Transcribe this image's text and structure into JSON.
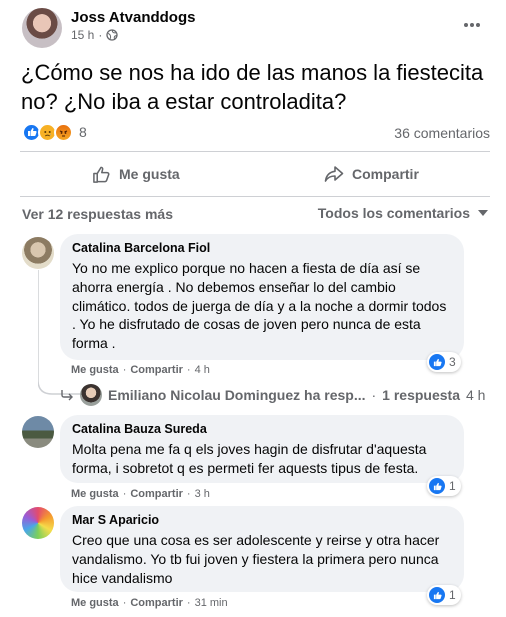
{
  "post": {
    "author": "Joss Atvanddogs",
    "time": "15 h",
    "privacy_icon": "globe-icon",
    "text": "¿Cómo se nos ha ido de las manos la fiestecita no? ¿No iba a estar controladita?",
    "reaction_count": "8",
    "comment_count": "36 comentarios"
  },
  "actions": {
    "like": "Me gusta",
    "share": "Compartir"
  },
  "comments_header": {
    "view_more": "Ver 12 respuestas más",
    "sort": "Todos los comentarios"
  },
  "comments": [
    {
      "name": "Catalina Barcelona Fiol",
      "text": "Yo no me explico porque no hacen a fiesta de día así se ahorra energía . No debemos enseñar lo del cambio climático. todos de juerga de día y a la noche a dormir todos . Yo he disfrutado de cosas de joven pero nunca de esta forma .",
      "like": "Me gusta",
      "reply": "Compartir",
      "time": "4 h",
      "reactions": "3",
      "reply_preview": {
        "text": "Emiliano Nicolau Dominguez ha resp...",
        "count": "1 respuesta",
        "time": "4 h"
      }
    },
    {
      "name": "Catalina Bauza Sureda",
      "text": "Molta pena me fa q els joves hagin de disfrutar d'aquesta forma, i sobretot q es permeti fer aquests tipus de festa.",
      "like": "Me gusta",
      "reply": "Compartir",
      "time": "3 h",
      "reactions": "1"
    },
    {
      "name": "Mar S Aparicio",
      "text": "Creo que una cosa es ser adolescente y reirse y otra hacer vandalismo. Yo tb fui joven y fiestera la primera pero nunca hice vandalismo",
      "like": "Me gusta",
      "reply": "Compartir",
      "time": "31 min",
      "reactions": "1"
    }
  ],
  "colors": {
    "accent": "#1877f2",
    "secondary_text": "#65676b",
    "bubble": "#f0f2f5"
  }
}
